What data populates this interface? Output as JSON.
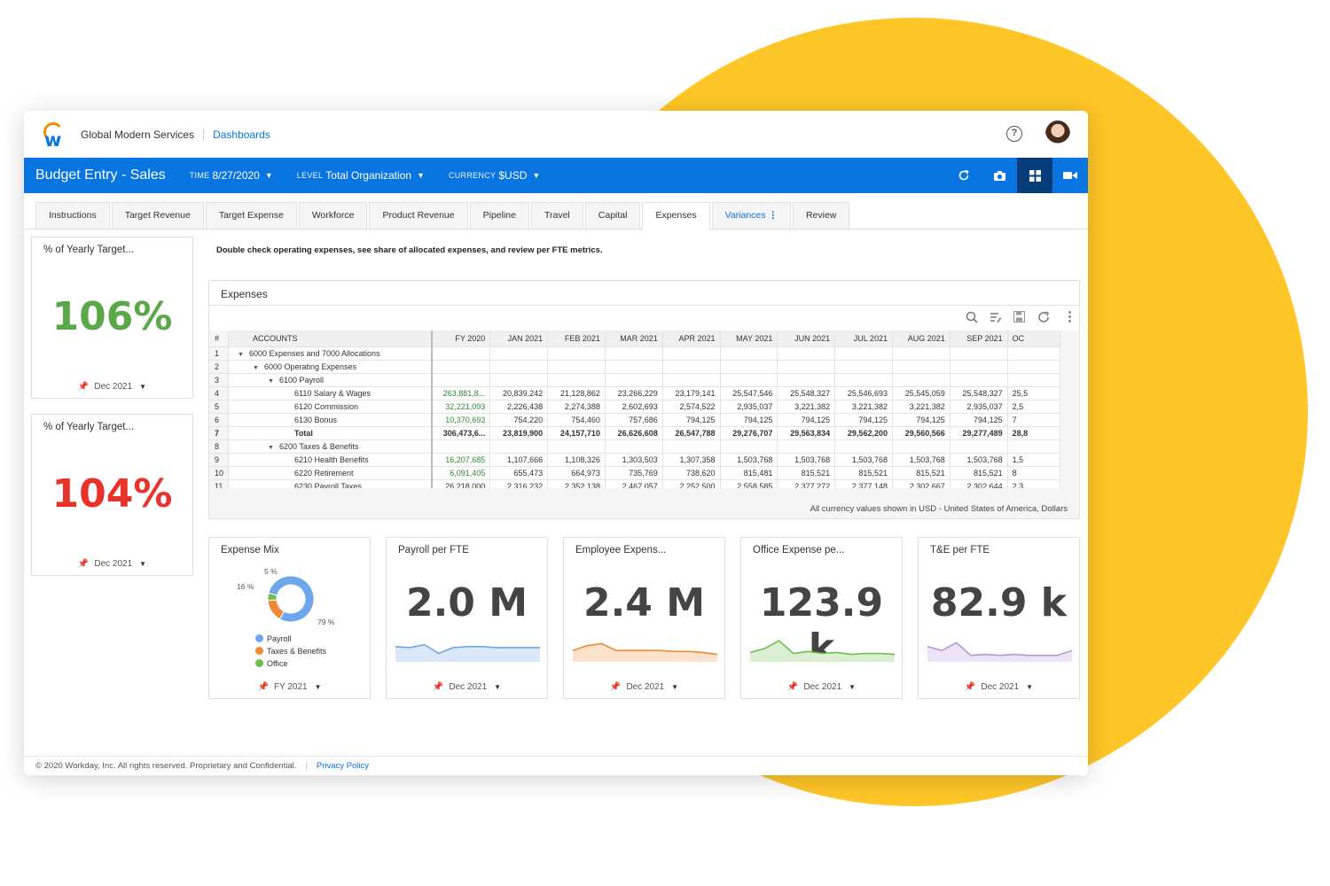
{
  "header": {
    "org": "Global Modern Services",
    "link": "Dashboards",
    "help": "?"
  },
  "bluebar": {
    "title": "Budget Entry - Sales",
    "time_label": "TIME",
    "time_value": "8/27/2020",
    "level_label": "LEVEL",
    "level_value": "Total Organization",
    "currency_label": "CURRENCY",
    "currency_value": "$USD",
    "icons": [
      "refresh-icon",
      "camera-icon",
      "grid-icon",
      "video-icon"
    ]
  },
  "tabs": [
    {
      "label": "Instructions"
    },
    {
      "label": "Target Revenue"
    },
    {
      "label": "Target Expense"
    },
    {
      "label": "Workforce"
    },
    {
      "label": "Product Revenue"
    },
    {
      "label": "Pipeline"
    },
    {
      "label": "Travel"
    },
    {
      "label": "Capital"
    },
    {
      "label": "Expenses"
    },
    {
      "label": "Variances"
    },
    {
      "label": "Review"
    }
  ],
  "side_kpis": [
    {
      "label": "% of Yearly Target...",
      "value": "106%",
      "color": "#5BA84A",
      "period": "Dec 2021"
    },
    {
      "label": "% of Yearly Target...",
      "value": "104%",
      "color": "#E8332A",
      "period": "Dec 2021"
    }
  ],
  "instruction": "Double check operating expenses, see share of allocated expenses, and review per FTE metrics.",
  "expenses": {
    "title": "Expenses",
    "headers": [
      "#",
      "ACCOUNTS",
      "FY 2020",
      "JAN 2021",
      "FEB 2021",
      "MAR 2021",
      "APR 2021",
      "MAY 2021",
      "JUN 2021",
      "JUL 2021",
      "AUG 2021",
      "SEP 2021",
      "OC"
    ],
    "rows": [
      [
        "1",
        "6000 Expenses and 7000 Allocations",
        "",
        "",
        "",
        "",
        "",
        "",
        "",
        "",
        "",
        "",
        ""
      ],
      [
        "2",
        "6000 Operating Expenses",
        "",
        "",
        "",
        "",
        "",
        "",
        "",
        "",
        "",
        "",
        ""
      ],
      [
        "3",
        "6100 Payroll",
        "",
        "",
        "",
        "",
        "",
        "",
        "",
        "",
        "",
        "",
        ""
      ],
      [
        "4",
        "6110 Salary & Wages",
        "263,881,8...",
        "20,839,242",
        "21,128,862",
        "23,266,229",
        "23,179,141",
        "25,547,546",
        "25,548,327",
        "25,546,693",
        "25,545,059",
        "25,548,327",
        "25,5"
      ],
      [
        "5",
        "6120 Commission",
        "32,221,093",
        "2,226,438",
        "2,274,388",
        "2,602,693",
        "2,574,522",
        "2,935,037",
        "3,221,382",
        "3,221,382",
        "3,221,382",
        "2,935,037",
        "2,5"
      ],
      [
        "6",
        "6130 Bonus",
        "10,370,693",
        "754,220",
        "754,460",
        "757,686",
        "794,125",
        "794,125",
        "794,125",
        "794,125",
        "794,125",
        "794,125",
        "7"
      ],
      [
        "7",
        "Total",
        "306,473,6...",
        "23,819,900",
        "24,157,710",
        "26,626,608",
        "26,547,788",
        "29,276,707",
        "29,563,834",
        "29,562,200",
        "29,560,566",
        "29,277,489",
        "28,8"
      ],
      [
        "8",
        "6200 Taxes & Benefits",
        "",
        "",
        "",
        "",
        "",
        "",
        "",
        "",
        "",
        "",
        ""
      ],
      [
        "9",
        "6210 Health Benefits",
        "16,207,685",
        "1,107,666",
        "1,108,326",
        "1,303,503",
        "1,307,358",
        "1,503,768",
        "1,503,768",
        "1,503,768",
        "1,503,768",
        "1,503,768",
        "1,5"
      ],
      [
        "10",
        "6220 Retirement",
        "6,091,405",
        "655,473",
        "664,973",
        "735,769",
        "738,620",
        "815,481",
        "815,521",
        "815,521",
        "815,521",
        "815,521",
        "8"
      ],
      [
        "11",
        "6230 Payroll Taxes",
        "26,218,000",
        "2,316,232",
        "2,352,138",
        "2,467,057",
        "2,252,500",
        "2,558,585",
        "2,377,272",
        "2,377,148",
        "2,302,667",
        "2,302,644",
        "2,3"
      ]
    ],
    "footnote": "All currency values shown in USD - United States of America, Dollars"
  },
  "cards": [
    {
      "label": "Expense Mix",
      "period": "FY 2021"
    },
    {
      "label": "Payroll per FTE",
      "value": "2.0 M",
      "period": "Dec 2021",
      "color": "#6EA6EC",
      "fill": "#dbe8f9",
      "spark": [
        12,
        11,
        14,
        5,
        11,
        12,
        12,
        11,
        11,
        11,
        11
      ]
    },
    {
      "label": "Employee Expens...",
      "value": "2.4 M",
      "period": "Dec 2021",
      "color": "#EE8A36",
      "fill": "#fbe2cc",
      "spark": [
        8,
        13,
        15,
        8,
        8,
        8,
        8,
        7,
        7,
        6,
        4
      ]
    },
    {
      "label": "Office Expense pe...",
      "value": "123.9 k",
      "period": "Dec 2021",
      "color": "#6DBE4B",
      "fill": "#dcefd2",
      "spark": [
        6,
        10,
        18,
        5,
        7,
        5,
        6,
        4,
        5,
        5,
        4
      ]
    },
    {
      "label": "T&E per FTE",
      "value": "82.9 k",
      "period": "Dec 2021",
      "color": "#B696D9",
      "fill": "#ece3f6",
      "spark": [
        12,
        8,
        16,
        3,
        4,
        3,
        4,
        3,
        3,
        3,
        8
      ]
    }
  ],
  "chart_data": {
    "type": "pie",
    "title": "Expense Mix",
    "categories": [
      "Payroll",
      "Taxes & Benefits",
      "Office"
    ],
    "values": [
      79,
      16,
      5
    ],
    "labels": [
      "79 %",
      "16 %",
      "5 %"
    ],
    "colors": [
      "#6EA6EC",
      "#EE8A36",
      "#6DBE4B"
    ],
    "legend": "bottom"
  },
  "footer": {
    "copyright": "© 2020 Workday, Inc. All rights reserved. Proprietary and Confidential.",
    "privacy": "Privacy Policy"
  }
}
